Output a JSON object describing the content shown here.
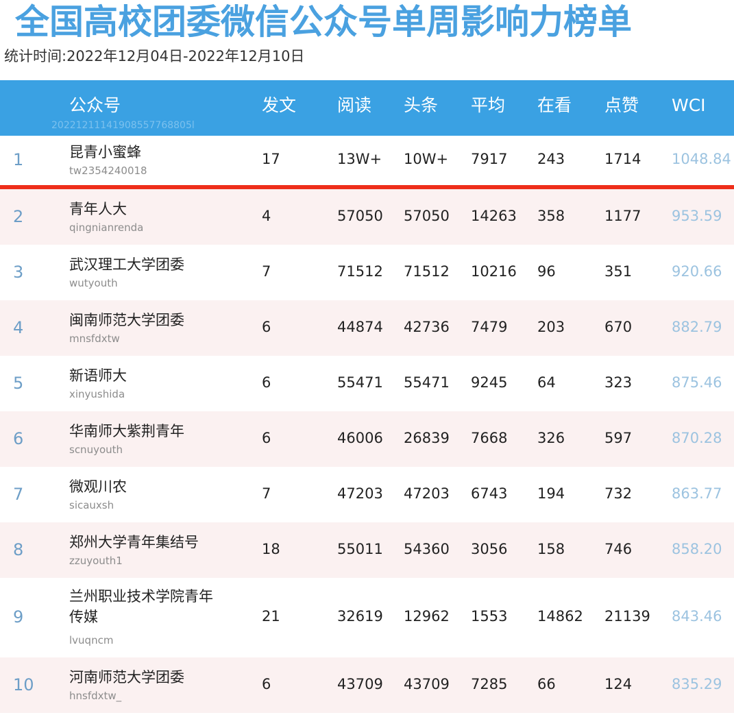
{
  "title": "全国高校团委微信公众号单周影响力榜单",
  "period": "统计时间:2022年12月04日-2022年12月10日",
  "header": {
    "account": "公众号",
    "posts": "发文",
    "reads": "阅读",
    "headline": "头条",
    "average": "平均",
    "watching": "在看",
    "likes": "点赞",
    "wci": "WCI",
    "watermark_id": "20221211141908557768805l"
  },
  "rows": [
    {
      "rank": "1",
      "name": "昆青小蜜蜂",
      "id": "tw2354240018",
      "posts": "17",
      "reads": "13W+",
      "headline": "10W+",
      "average": "7917",
      "watching": "243",
      "likes": "1714",
      "wci": "1048.84"
    },
    {
      "rank": "2",
      "name": "青年人大",
      "id": "qingnianrenda",
      "posts": "4",
      "reads": "57050",
      "headline": "57050",
      "average": "14263",
      "watching": "358",
      "likes": "1177",
      "wci": "953.59"
    },
    {
      "rank": "3",
      "name": "武汉理工大学团委",
      "id": "wutyouth",
      "posts": "7",
      "reads": "71512",
      "headline": "71512",
      "average": "10216",
      "watching": "96",
      "likes": "351",
      "wci": "920.66"
    },
    {
      "rank": "4",
      "name": "闽南师范大学团委",
      "id": "mnsfdxtw",
      "posts": "6",
      "reads": "44874",
      "headline": "42736",
      "average": "7479",
      "watching": "203",
      "likes": "670",
      "wci": "882.79"
    },
    {
      "rank": "5",
      "name": "新语师大",
      "id": "xinyushida",
      "posts": "6",
      "reads": "55471",
      "headline": "55471",
      "average": "9245",
      "watching": "64",
      "likes": "323",
      "wci": "875.46"
    },
    {
      "rank": "6",
      "name": "华南师大紫荆青年",
      "id": "scnuyouth",
      "posts": "6",
      "reads": "46006",
      "headline": "26839",
      "average": "7668",
      "watching": "326",
      "likes": "597",
      "wci": "870.28"
    },
    {
      "rank": "7",
      "name": "微观川农",
      "id": "sicauxsh",
      "posts": "7",
      "reads": "47203",
      "headline": "47203",
      "average": "6743",
      "watching": "194",
      "likes": "732",
      "wci": "863.77"
    },
    {
      "rank": "8",
      "name": "郑州大学青年集结号",
      "id": "zzuyouth1",
      "posts": "18",
      "reads": "55011",
      "headline": "54360",
      "average": "3056",
      "watching": "158",
      "likes": "746",
      "wci": "858.20"
    },
    {
      "rank": "9",
      "name": "兰州职业技术学院青年传媒",
      "id": "lvuqncm",
      "posts": "21",
      "reads": "32619",
      "headline": "12962",
      "average": "1553",
      "watching": "14862",
      "likes": "21139",
      "wci": "843.46"
    },
    {
      "rank": "10",
      "name": "河南师范大学团委",
      "id": "hnsfdxtw_",
      "posts": "6",
      "reads": "43709",
      "headline": "43709",
      "average": "7285",
      "watching": "66",
      "likes": "124",
      "wci": "835.29"
    }
  ],
  "colors": {
    "title": "#4aa1e0",
    "header_bg": "#3aa1e3",
    "row_alt_bg": "#fbf1f1",
    "rank": "#6d9ec7",
    "wci": "#9cc3e0",
    "top_divider": "#ee2e1a"
  }
}
